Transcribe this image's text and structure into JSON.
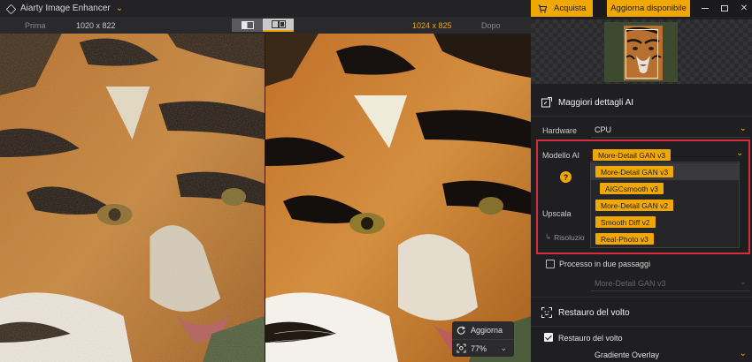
{
  "app": {
    "title": "Aiarty Image Enhancer"
  },
  "compare": {
    "before_label": "Prima",
    "before_size": "1020 x 822",
    "after_size": "1024 x 825",
    "after_label": "Dopo"
  },
  "zoom": {
    "refresh_label": "Aggiorna",
    "zoom_value": "77%"
  },
  "topbar": {
    "buy_label": "Acquista",
    "update_label": "Aggiorna disponibile"
  },
  "section_detail": {
    "title": "Maggiori dettagli AI",
    "hardware_label": "Hardware",
    "hardware_value": "CPU",
    "model_label": "Modello AI",
    "model_value": "More-Detail GAN  v3",
    "help_icon_glyph": "?",
    "model_options": [
      "More-Detail GAN  v3",
      "AIGCsmooth  v3",
      "More-Detail GAN  v2",
      "Smooth Diff  v2",
      "Real-Photo  v3"
    ],
    "upscale_label": "Upscala",
    "resolution_label": "Risoluzio",
    "two_pass_label": "Processo in due passaggi",
    "two_pass_model": "More-Detail GAN  v3"
  },
  "section_face": {
    "title": "Restauro del volto",
    "enable_label": "Restauro del volto",
    "enabled": true,
    "model_value": "Gradiente Overlay"
  },
  "colors": {
    "accent": "#f0a800",
    "highlight_frame": "#d62d3c",
    "panel_bg": "#1f1f21"
  }
}
